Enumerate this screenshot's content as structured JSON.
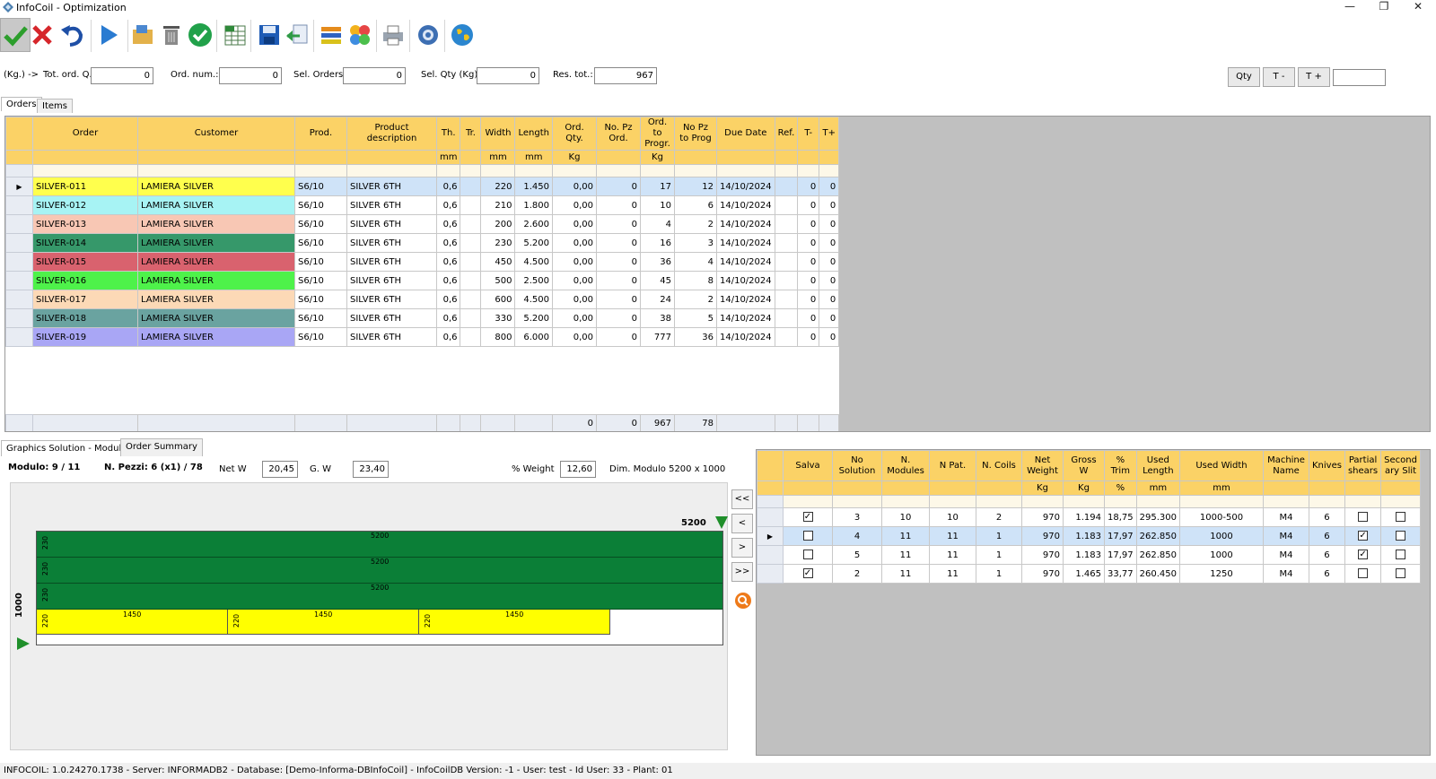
{
  "window": {
    "title": "InfoCoil - Optimization",
    "minimize": "—",
    "restore": "❐",
    "close": "✕"
  },
  "toolbar": {
    "icons": [
      "confirm-icon",
      "cancel-icon",
      "undo-icon",
      "run-icon",
      "open-folder-icon",
      "delete-icon",
      "approve-icon",
      "spreadsheet-icon",
      "save-icon",
      "import-icon",
      "layers-icon",
      "puzzle-icon",
      "print-icon",
      "settings-icon",
      "globe-icon"
    ]
  },
  "fields": {
    "unit": "(Kg.) ->",
    "tot_ord_q_label": "Tot. ord. Q.:",
    "tot_ord_q": "0",
    "ord_num_label": "Ord. num.:",
    "ord_num": "0",
    "sel_orders_label": "Sel. Orders",
    "sel_orders": "0",
    "sel_qty_label": "Sel. Qty (Kg)",
    "sel_qty": "0",
    "res_tot_label": "Res. tot.:",
    "res_tot": "967",
    "qty_button": "Qty",
    "t_minus_button": "T -",
    "t_plus_button": "T +",
    "t_value": ""
  },
  "tabs": {
    "orders": "Orders",
    "items": "Items"
  },
  "orders": {
    "columns": [
      {
        "name": "Order",
        "unit": ""
      },
      {
        "name": "Customer",
        "unit": ""
      },
      {
        "name": "Prod.",
        "unit": ""
      },
      {
        "name": "Product description",
        "unit": ""
      },
      {
        "name": "Th.",
        "unit": "mm"
      },
      {
        "name": "Tr.",
        "unit": ""
      },
      {
        "name": "Width",
        "unit": "mm"
      },
      {
        "name": "Length",
        "unit": "mm"
      },
      {
        "name": "Ord. Qty.",
        "unit": "Kg"
      },
      {
        "name": "No. Pz Ord.",
        "unit": ""
      },
      {
        "name": "Ord. to Progr.",
        "unit": "Kg"
      },
      {
        "name": "No Pz to Prog",
        "unit": ""
      },
      {
        "name": "Due Date",
        "unit": ""
      },
      {
        "name": "Ref.",
        "unit": ""
      },
      {
        "name": "T-",
        "unit": ""
      },
      {
        "name": "T+",
        "unit": ""
      }
    ],
    "rows": [
      {
        "order": "SILVER-011",
        "customer": "LAMIERA SILVER",
        "prod": "S6/10",
        "desc": "SILVER 6TH",
        "th": "0,6",
        "tr": "",
        "width": "220",
        "length": "1.450",
        "ord_qty": "0,00",
        "pz_ord": "0",
        "ord_prog": "17",
        "pz_prog": "12",
        "due": "14/10/2024",
        "ref": "",
        "tm": "0",
        "tp": "0",
        "color": "#ffff4d",
        "selected": true
      },
      {
        "order": "SILVER-012",
        "customer": "LAMIERA SILVER",
        "prod": "S6/10",
        "desc": "SILVER 6TH",
        "th": "0,6",
        "tr": "",
        "width": "210",
        "length": "1.800",
        "ord_qty": "0,00",
        "pz_ord": "0",
        "ord_prog": "10",
        "pz_prog": "6",
        "due": "14/10/2024",
        "ref": "",
        "tm": "0",
        "tp": "0",
        "color": "#a7f3f4",
        "selected": false
      },
      {
        "order": "SILVER-013",
        "customer": "LAMIERA SILVER",
        "prod": "S6/10",
        "desc": "SILVER 6TH",
        "th": "0,6",
        "tr": "",
        "width": "200",
        "length": "2.600",
        "ord_qty": "0,00",
        "pz_ord": "0",
        "ord_prog": "4",
        "pz_prog": "2",
        "due": "14/10/2024",
        "ref": "",
        "tm": "0",
        "tp": "0",
        "color": "#f8c7b4",
        "selected": false
      },
      {
        "order": "SILVER-014",
        "customer": "LAMIERA SILVER",
        "prod": "S6/10",
        "desc": "SILVER 6TH",
        "th": "0,6",
        "tr": "",
        "width": "230",
        "length": "5.200",
        "ord_qty": "0,00",
        "pz_ord": "0",
        "ord_prog": "16",
        "pz_prog": "3",
        "due": "14/10/2024",
        "ref": "",
        "tm": "0",
        "tp": "0",
        "color": "#36986a",
        "selected": false
      },
      {
        "order": "SILVER-015",
        "customer": "LAMIERA SILVER",
        "prod": "S6/10",
        "desc": "SILVER 6TH",
        "th": "0,6",
        "tr": "",
        "width": "450",
        "length": "4.500",
        "ord_qty": "0,00",
        "pz_ord": "0",
        "ord_prog": "36",
        "pz_prog": "4",
        "due": "14/10/2024",
        "ref": "",
        "tm": "0",
        "tp": "0",
        "color": "#d9626e",
        "selected": false
      },
      {
        "order": "SILVER-016",
        "customer": "LAMIERA SILVER",
        "prod": "S6/10",
        "desc": "SILVER 6TH",
        "th": "0,6",
        "tr": "",
        "width": "500",
        "length": "2.500",
        "ord_qty": "0,00",
        "pz_ord": "0",
        "ord_prog": "45",
        "pz_prog": "8",
        "due": "14/10/2024",
        "ref": "",
        "tm": "0",
        "tp": "0",
        "color": "#4ef24a",
        "selected": false
      },
      {
        "order": "SILVER-017",
        "customer": "LAMIERA SILVER",
        "prod": "S6/10",
        "desc": "SILVER 6TH",
        "th": "0,6",
        "tr": "",
        "width": "600",
        "length": "4.500",
        "ord_qty": "0,00",
        "pz_ord": "0",
        "ord_prog": "24",
        "pz_prog": "2",
        "due": "14/10/2024",
        "ref": "",
        "tm": "0",
        "tp": "0",
        "color": "#fcd9b6",
        "selected": false
      },
      {
        "order": "SILVER-018",
        "customer": "LAMIERA SILVER",
        "prod": "S6/10",
        "desc": "SILVER 6TH",
        "th": "0,6",
        "tr": "",
        "width": "330",
        "length": "5.200",
        "ord_qty": "0,00",
        "pz_ord": "0",
        "ord_prog": "38",
        "pz_prog": "5",
        "due": "14/10/2024",
        "ref": "",
        "tm": "0",
        "tp": "0",
        "color": "#6aa3a0",
        "selected": false
      },
      {
        "order": "SILVER-019",
        "customer": "LAMIERA SILVER",
        "prod": "S6/10",
        "desc": "SILVER 6TH",
        "th": "0,6",
        "tr": "",
        "width": "800",
        "length": "6.000",
        "ord_qty": "0,00",
        "pz_ord": "0",
        "ord_prog": "777",
        "pz_prog": "36",
        "due": "14/10/2024",
        "ref": "",
        "tm": "0",
        "tp": "0",
        "color": "#a9a6f5",
        "selected": false
      }
    ],
    "totals": {
      "ord_qty": "0",
      "pz_ord": "0",
      "ord_prog": "967",
      "pz_prog": "78"
    }
  },
  "lower_tabs": {
    "graphics": "Graphics Solution - Module",
    "summary": "Order Summary"
  },
  "module": {
    "modulo_label": "Modulo: 9 / 11",
    "pezzi_label": "N. Pezzi: 6 (x1) / 78",
    "net_w_label": "Net W",
    "net_w": "20,45",
    "g_w_label": "G. W",
    "g_w": "23,40",
    "weight_label": "% Weight",
    "weight": "12,60",
    "dim_label": "Dim. Modulo 5200 x 1000",
    "length_mark": "5200",
    "width_mark": "1000",
    "strips": [
      {
        "side": "230",
        "label": "5200",
        "color": "#0b7f37"
      },
      {
        "side": "230",
        "label": "5200",
        "color": "#0b7f37"
      },
      {
        "side": "230",
        "label": "5200",
        "color": "#0b7f37"
      }
    ],
    "pieces": [
      {
        "side": "220",
        "label": "1450",
        "color": "#ffff00"
      },
      {
        "side": "220",
        "label": "1450",
        "color": "#ffff00"
      },
      {
        "side": "220",
        "label": "1450",
        "color": "#ffff00"
      }
    ],
    "nav": [
      "<<",
      "<",
      ">",
      ">>"
    ]
  },
  "solutions": {
    "columns": [
      {
        "name": "Salva",
        "unit": ""
      },
      {
        "name": "No Solution",
        "unit": ""
      },
      {
        "name": "N. Modules",
        "unit": ""
      },
      {
        "name": "N Pat.",
        "unit": ""
      },
      {
        "name": "N. Coils",
        "unit": ""
      },
      {
        "name": "Net Weight",
        "unit": "Kg"
      },
      {
        "name": "Gross W",
        "unit": "Kg"
      },
      {
        "name": "% Trim",
        "unit": "%"
      },
      {
        "name": "Used Length",
        "unit": "mm"
      },
      {
        "name": "Used Width",
        "unit": "mm"
      },
      {
        "name": "Machine Name",
        "unit": ""
      },
      {
        "name": "Knives",
        "unit": ""
      },
      {
        "name": "Partial shears",
        "unit": ""
      },
      {
        "name": "Second ary Slit",
        "unit": ""
      }
    ],
    "rows": [
      {
        "salva": true,
        "no": "3",
        "modules": "10",
        "pat": "10",
        "coils": "2",
        "net": "970",
        "gross": "1.194",
        "trim": "18,75",
        "ulen": "295.300",
        "uwid": "1000-500",
        "machine": "M4",
        "knives": "6",
        "partial": false,
        "secondary": false,
        "selected": false
      },
      {
        "salva": false,
        "no": "4",
        "modules": "11",
        "pat": "11",
        "coils": "1",
        "net": "970",
        "gross": "1.183",
        "trim": "17,97",
        "ulen": "262.850",
        "uwid": "1000",
        "machine": "M4",
        "knives": "6",
        "partial": true,
        "secondary": false,
        "selected": true
      },
      {
        "salva": false,
        "no": "5",
        "modules": "11",
        "pat": "11",
        "coils": "1",
        "net": "970",
        "gross": "1.183",
        "trim": "17,97",
        "ulen": "262.850",
        "uwid": "1000",
        "machine": "M4",
        "knives": "6",
        "partial": true,
        "secondary": false,
        "selected": false
      },
      {
        "salva": true,
        "no": "2",
        "modules": "11",
        "pat": "11",
        "coils": "1",
        "net": "970",
        "gross": "1.465",
        "trim": "33,77",
        "ulen": "260.450",
        "uwid": "1250",
        "machine": "M4",
        "knives": "6",
        "partial": false,
        "secondary": false,
        "selected": false
      }
    ]
  },
  "status": "INFOCOIL: 1.0.24270.1738 - Server: INFORMADB2 - Database: [Demo-Informa-DBInfoCoil] - InfoCoilDB Version:  -1 - User: test - Id User: 33 - Plant: 01"
}
